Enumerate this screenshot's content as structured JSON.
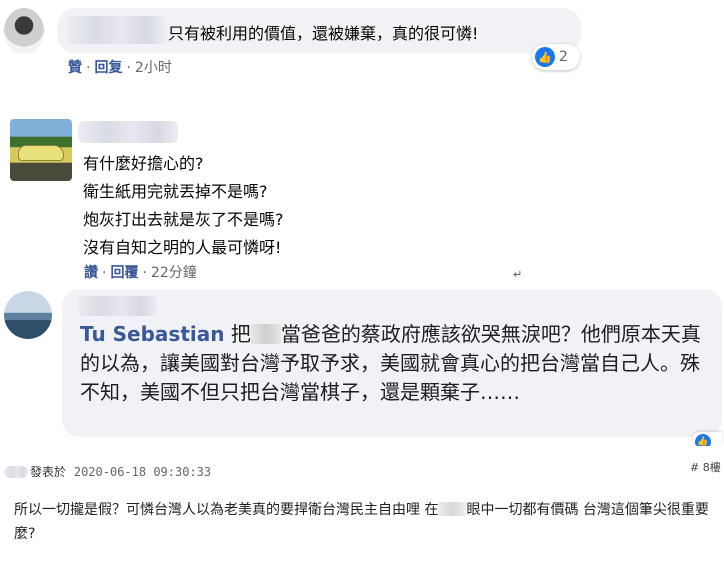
{
  "comments": [
    {
      "text": "只有被利用的價值，還被嫌棄，真的很可憐!",
      "actions": {
        "like": "贊",
        "reply": "回复",
        "time": "2小时"
      },
      "reaction_count": "2"
    },
    {
      "lines": "有什麼好擔心的?\n衛生紙用完就丟掉不是嗎?\n炮灰打出去就是灰了不是嗎?\n沒有自知之明的人最可憐呀!",
      "actions": {
        "like": "讚",
        "reply": "回覆",
        "time": "22分鐘"
      }
    },
    {
      "mention": "Tu Sebastian",
      "text_a": "把",
      "text_b": "當爸爸的蔡政府應該欲哭無淚吧？他們原本天真的以為，讓美國對台灣予取予求，美國就會真心的把台灣當自己人。殊不知，美國不但只把台灣當棋子，還是顆棄子……"
    }
  ],
  "post": {
    "posted_label": "發表於",
    "timestamp": "2020-06-18 09:30:33",
    "floor": "# 8樓",
    "body_a": "所以一切攏是假？可憐台灣人以為老美真的要捍衛台灣民主自由哩 在",
    "body_b": "眼中一切都有價碼 台灣這個筆尖很重要麼?"
  },
  "icons": {
    "like": "like-thumb-icon",
    "avatar_1": "user-avatar",
    "avatar_2": "car-avatar",
    "avatar_3": "landscape-avatar"
  },
  "colors": {
    "link": "#385898",
    "bubble": "#f0f2f5",
    "like_blue": "#1877f2"
  }
}
